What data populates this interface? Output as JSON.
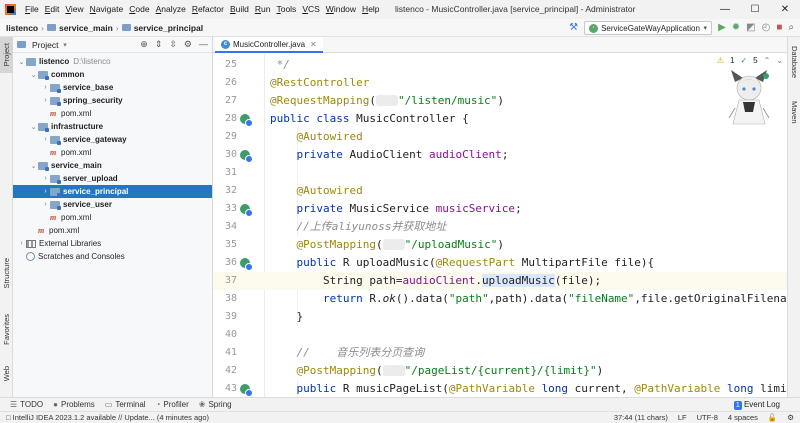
{
  "titlebar": {
    "menu": [
      "File",
      "Edit",
      "View",
      "Navigate",
      "Code",
      "Analyze",
      "Refactor",
      "Build",
      "Run",
      "Tools",
      "VCS",
      "Window",
      "Help"
    ],
    "window_title": "listenco - MusicController.java [service_principal] - Administrator",
    "controls": [
      "—",
      "☐",
      "✕"
    ]
  },
  "navbar": {
    "crumbs": [
      "listenco",
      "service_main",
      "service_principal"
    ],
    "run_config": "ServiceGateWayApplication"
  },
  "left_strip": {
    "tabs": [
      "Project",
      "Structure",
      "Favorites",
      "Web"
    ]
  },
  "right_strip": {
    "tabs": [
      "Database",
      "Maven"
    ]
  },
  "project_panel": {
    "title": "Project",
    "tree": [
      {
        "label": "listenco",
        "suffix": "D:\\listenco",
        "bold": true,
        "chev": "⌄",
        "indent": 0,
        "icon": "folder"
      },
      {
        "label": "common",
        "bold": true,
        "chev": "⌄",
        "indent": 1,
        "icon": "folder-mod"
      },
      {
        "label": "service_base",
        "bold": true,
        "chev": "›",
        "indent": 2,
        "icon": "folder-mod"
      },
      {
        "label": "spring_security",
        "bold": true,
        "chev": "›",
        "indent": 2,
        "icon": "folder-mod"
      },
      {
        "label": "pom.xml",
        "bold": false,
        "chev": "",
        "indent": 2,
        "icon": "maven"
      },
      {
        "label": "infrastructure",
        "bold": true,
        "chev": "⌄",
        "indent": 1,
        "icon": "folder-mod"
      },
      {
        "label": "service_gateway",
        "bold": true,
        "chev": "›",
        "indent": 2,
        "icon": "folder-mod"
      },
      {
        "label": "pom.xml",
        "bold": false,
        "chev": "",
        "indent": 2,
        "icon": "maven"
      },
      {
        "label": "service_main",
        "bold": true,
        "chev": "⌄",
        "indent": 1,
        "icon": "folder-mod"
      },
      {
        "label": "server_upload",
        "bold": true,
        "chev": "›",
        "indent": 2,
        "icon": "folder-mod"
      },
      {
        "label": "service_principal",
        "bold": true,
        "chev": "›",
        "indent": 2,
        "icon": "folder-mod",
        "selected": true
      },
      {
        "label": "service_user",
        "bold": true,
        "chev": "›",
        "indent": 2,
        "icon": "folder-mod"
      },
      {
        "label": "pom.xml",
        "bold": false,
        "chev": "",
        "indent": 2,
        "icon": "maven"
      },
      {
        "label": "pom.xml",
        "bold": false,
        "chev": "",
        "indent": 1,
        "icon": "maven"
      },
      {
        "label": "External Libraries",
        "bold": false,
        "chev": "›",
        "indent": 0,
        "icon": "lib"
      },
      {
        "label": "Scratches and Consoles",
        "bold": false,
        "chev": "",
        "indent": 0,
        "icon": "scratch"
      }
    ]
  },
  "editor": {
    "tab_label": "MusicController.java",
    "inspections": {
      "warnings": "1",
      "infos": "5"
    },
    "lines": [
      {
        "n": "25",
        "html": " */",
        "cls": "cmt"
      },
      {
        "n": "26",
        "html": "<span class=\"an\">@RestController</span>"
      },
      {
        "n": "27",
        "html": "<span class=\"an\">@RequestMapping</span>(<span class=\"inlay\"></span><span class=\"str\">\"/listen/music\"</span>)"
      },
      {
        "n": "28",
        "html": "<span class=\"kw\">public class</span> MusicController {",
        "icon": true
      },
      {
        "n": "29",
        "html": "    <span class=\"an\">@Autowired</span>"
      },
      {
        "n": "30",
        "html": "    <span class=\"kw\">private</span> AudioClient <span class=\"fld\">audioClient</span>;",
        "icon": true
      },
      {
        "n": "31",
        "html": ""
      },
      {
        "n": "32",
        "html": "    <span class=\"an\">@Autowired</span>"
      },
      {
        "n": "33",
        "html": "    <span class=\"kw\">private</span> MusicService <span class=\"fld\">musicService</span>;",
        "icon": true
      },
      {
        "n": "34",
        "html": "    <span class=\"cmt\">//上传aliyunoss并获取地址</span>"
      },
      {
        "n": "35",
        "html": "    <span class=\"an\">@PostMapping</span>(<span class=\"inlay\"></span><span class=\"str\">\"/uploadMusic\"</span>)"
      },
      {
        "n": "36",
        "html": "    <span class=\"kw\">public</span> R uploadMusic(<span class=\"an\">@RequestPart</span> MultipartFile file){",
        "icon": true
      },
      {
        "n": "37",
        "html": "        String path=<span class=\"fld\">audioClient</span>.<span class=\"hl\">uploadMusic</span>(file);",
        "current": true
      },
      {
        "n": "38",
        "html": "        <span class=\"kw\">return</span> R.<span class=\"ital\">ok</span>().data(<span class=\"str\">\"path\"</span>,path).data(<span class=\"str\">\"fileName\"</span>,file.getOriginalFilena"
      },
      {
        "n": "39",
        "html": "    }"
      },
      {
        "n": "40",
        "html": ""
      },
      {
        "n": "41",
        "html": "    <span class=\"cmt\">//    音乐列表分页查询</span>"
      },
      {
        "n": "42",
        "html": "    <span class=\"an\">@PostMapping</span>(<span class=\"inlay\"></span><span class=\"str\">\"/pageList/{current}/{limit}\"</span>)"
      },
      {
        "n": "43",
        "html": "    <span class=\"kw\">public</span> R musicPageList(<span class=\"an\">@PathVariable</span> <span class=\"kw\">long</span> current, <span class=\"an\">@PathVariable</span> <span class=\"kw\">long</span> limi",
        "icon": true
      }
    ]
  },
  "bottom_tools": {
    "items": [
      {
        "icon": "☰",
        "label": "TODO"
      },
      {
        "icon": "●",
        "label": "Problems"
      },
      {
        "icon": "▭",
        "label": "Terminal"
      },
      {
        "icon": "◔",
        "label": "Profiler"
      },
      {
        "icon": "❀",
        "label": "Spring"
      }
    ],
    "event_log": "Event Log",
    "event_count": "1"
  },
  "statusbar": {
    "message": "IntelliJ IDEA 2023.1.2 available // Update... (4 minutes ago)",
    "position": "37:44 (11 chars)",
    "line_sep": "LF",
    "encoding": "UTF-8",
    "indent": "4 spaces"
  }
}
